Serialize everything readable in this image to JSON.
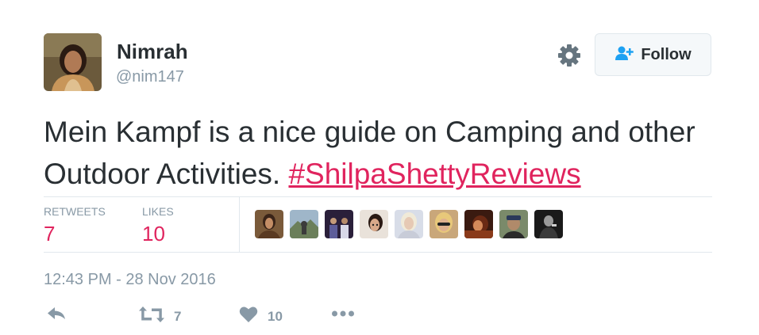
{
  "user": {
    "name": "Nimrah",
    "handle": "@nim147"
  },
  "follow_button": {
    "label": "Follow",
    "icon": "add-user-icon"
  },
  "settings_icon": "gear-icon",
  "tweet": {
    "text": "Mein Kampf is a nice guide on Camping and other Outdoor Activities.",
    "hashtag": "#ShilpaShettyReviews"
  },
  "stats": {
    "retweets_label": "RETWEETS",
    "retweets_count": "7",
    "likes_label": "LIKES",
    "likes_count": "10"
  },
  "likers_avatars": [
    "avatar-1",
    "avatar-2",
    "avatar-3",
    "avatar-4",
    "avatar-5",
    "avatar-6",
    "avatar-7",
    "avatar-8",
    "avatar-9"
  ],
  "timestamp": "12:43 PM - 28 Nov 2016",
  "actions": {
    "reply_icon": "reply-icon",
    "retweet_icon": "retweet-icon",
    "retweet_count": "7",
    "like_icon": "heart-icon",
    "like_count": "10",
    "more_icon": "more-icon"
  },
  "colors": {
    "text": "#292f33",
    "muted": "#8899a6",
    "accent_link": "#e0245e",
    "follow_icon": "#1da1f2",
    "border": "#e1e8ed",
    "button_bg": "#f5f8fa"
  }
}
